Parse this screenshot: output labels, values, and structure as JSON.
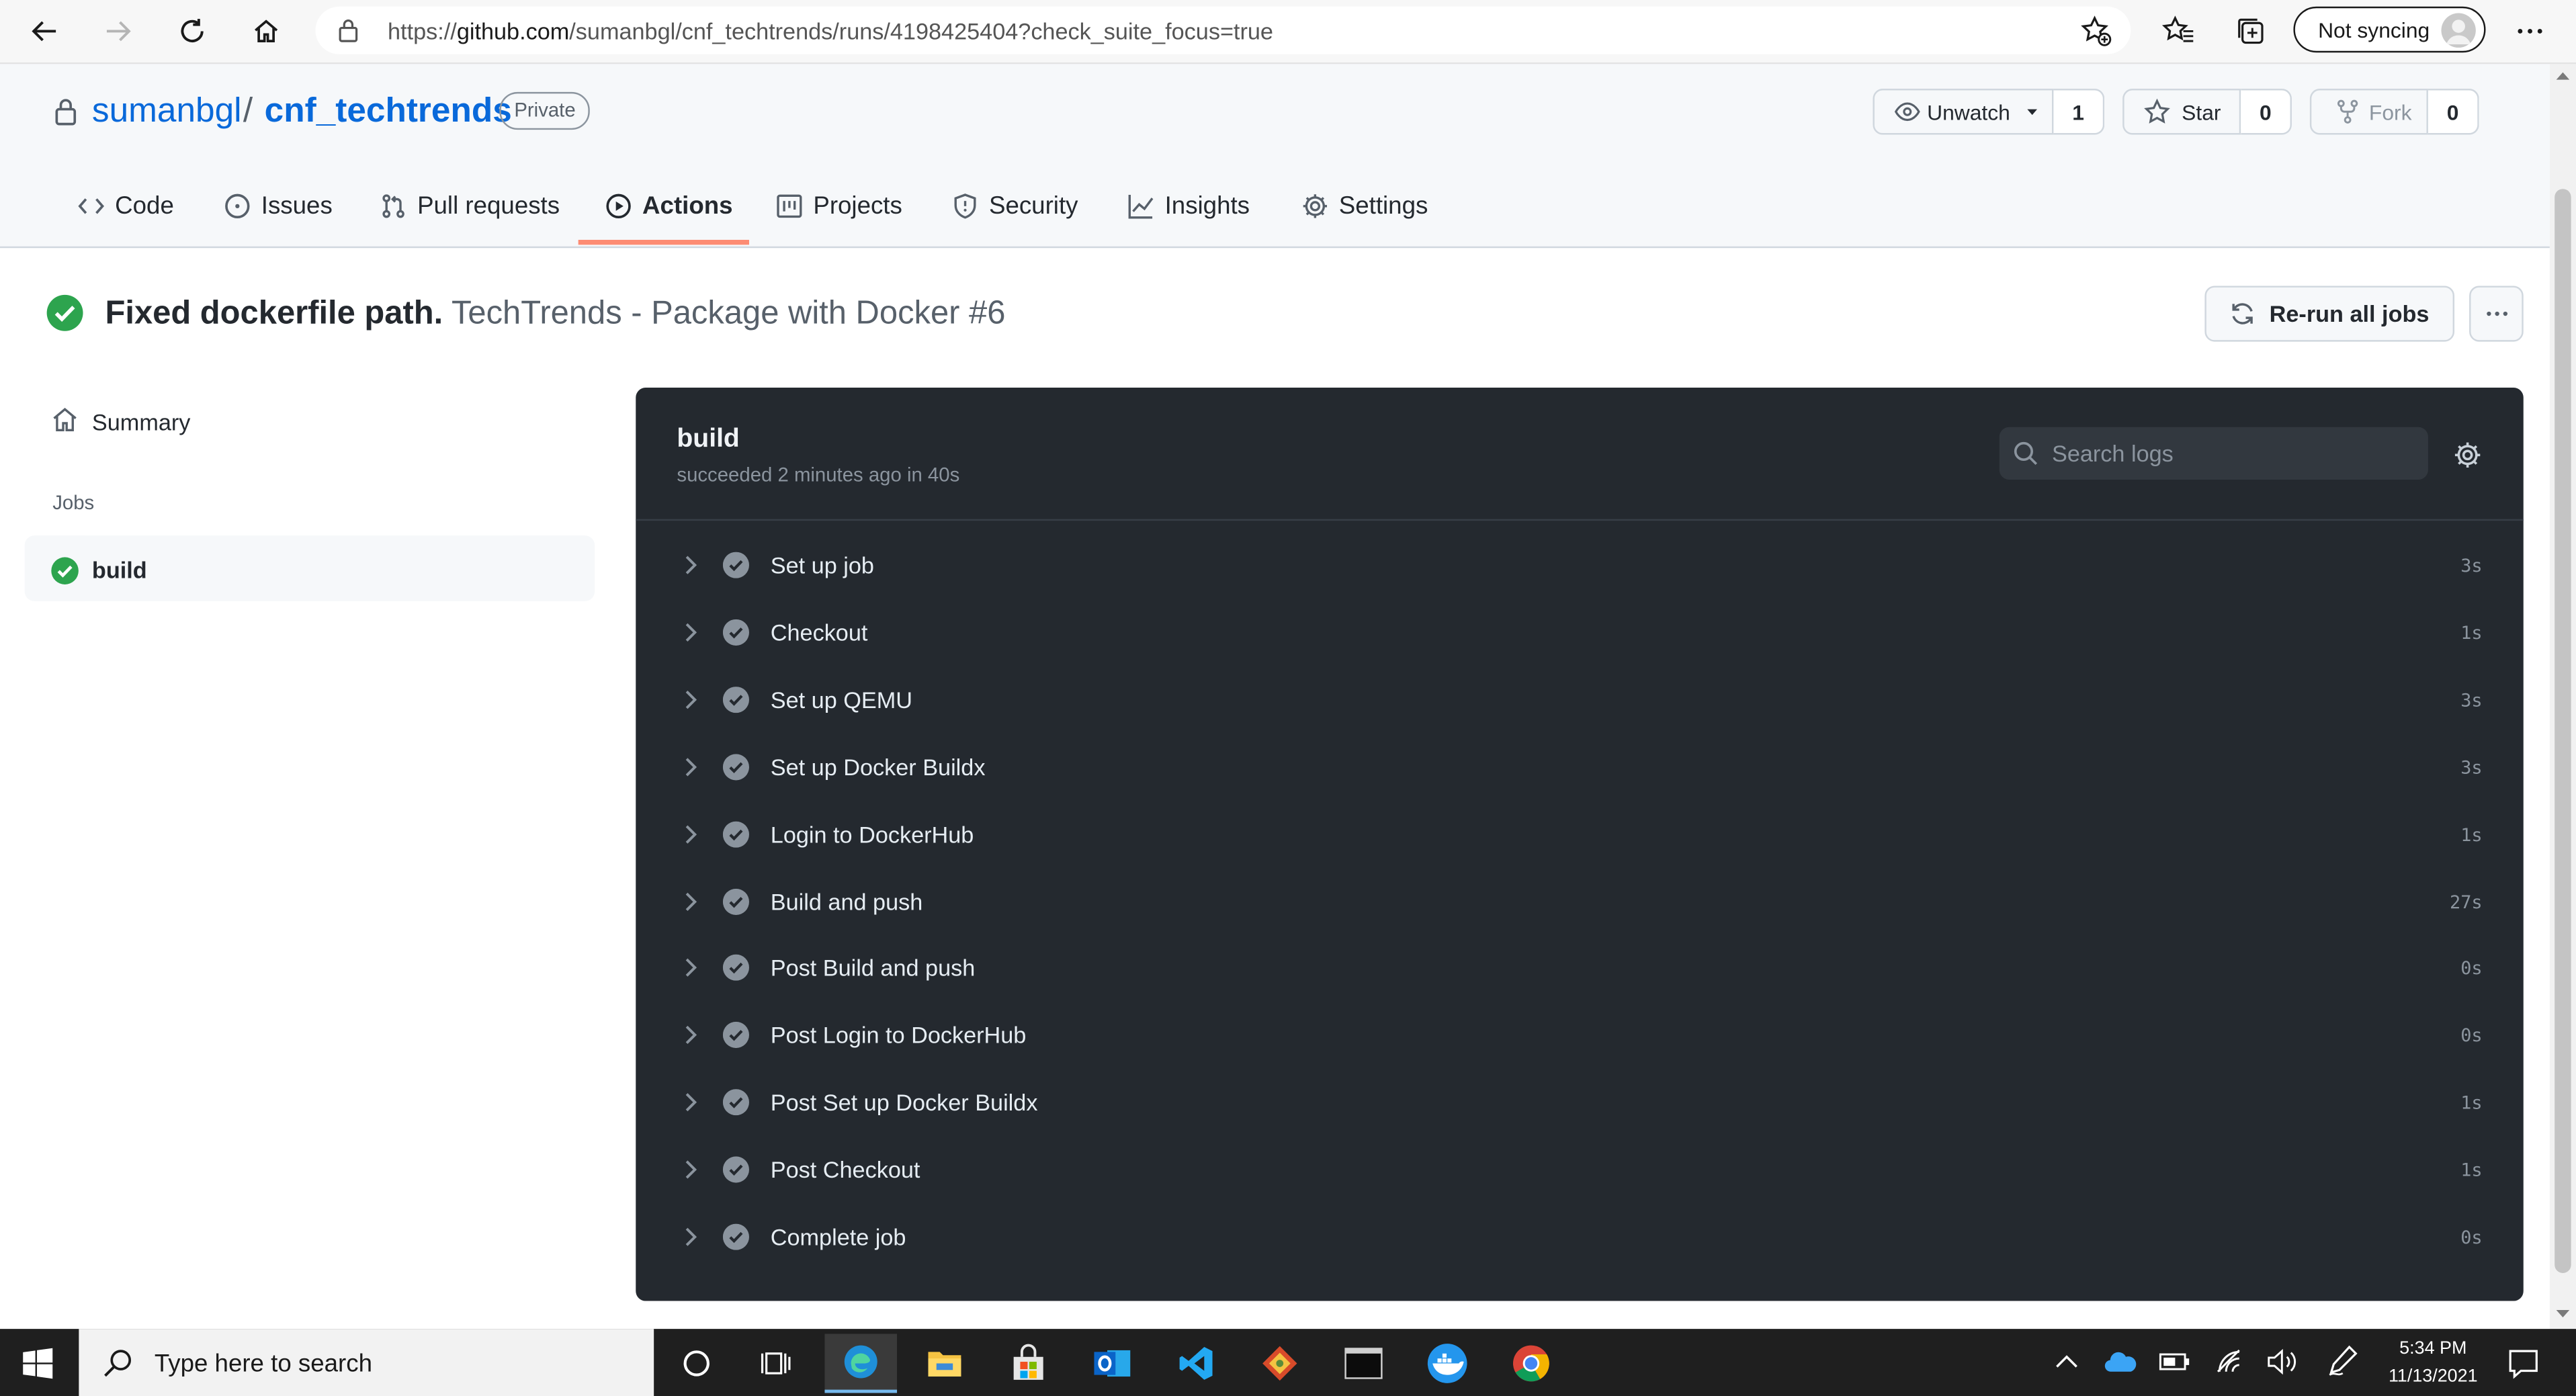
{
  "browser": {
    "url_base": "https://",
    "url_host": "github.com",
    "url_path": "/sumanbgl/cnf_techtrends/runs/4198425404?check_suite_focus=true",
    "profile_label": "Not syncing"
  },
  "repo": {
    "owner": "sumanbgl",
    "separator": "/",
    "name": "cnf_techtrends",
    "visibility": "Private",
    "unwatch_label": "Unwatch",
    "watch_count": "1",
    "star_label": "Star",
    "star_count": "0",
    "fork_label": "Fork",
    "fork_count": "0"
  },
  "tabs": [
    {
      "label": "Code",
      "icon": "code-icon"
    },
    {
      "label": "Issues",
      "icon": "issue-icon"
    },
    {
      "label": "Pull requests",
      "icon": "pull-request-icon"
    },
    {
      "label": "Actions",
      "icon": "play-icon",
      "active": true
    },
    {
      "label": "Projects",
      "icon": "project-icon"
    },
    {
      "label": "Security",
      "icon": "shield-icon"
    },
    {
      "label": "Insights",
      "icon": "graph-icon"
    },
    {
      "label": "Settings",
      "icon": "gear-icon"
    }
  ],
  "run": {
    "commit_message": "Fixed dockerfile path.",
    "workflow": "TechTrends - Package with Docker #6",
    "rerun_label": "Re-run all jobs"
  },
  "sidebar": {
    "summary_label": "Summary",
    "jobs_heading": "Jobs",
    "job_name": "build"
  },
  "log": {
    "job_title": "build",
    "job_status": "succeeded 2 minutes ago in 40s",
    "search_placeholder": "Search logs",
    "steps": [
      {
        "label": "Set up job",
        "time": "3s"
      },
      {
        "label": "Checkout",
        "time": "1s"
      },
      {
        "label": "Set up QEMU",
        "time": "3s"
      },
      {
        "label": "Set up Docker Buildx",
        "time": "3s"
      },
      {
        "label": "Login to DockerHub",
        "time": "1s"
      },
      {
        "label": "Build and push",
        "time": "27s"
      },
      {
        "label": "Post Build and push",
        "time": "0s"
      },
      {
        "label": "Post Login to DockerHub",
        "time": "0s"
      },
      {
        "label": "Post Set up Docker Buildx",
        "time": "1s"
      },
      {
        "label": "Post Checkout",
        "time": "1s"
      },
      {
        "label": "Complete job",
        "time": "0s"
      }
    ]
  },
  "taskbar": {
    "search_placeholder": "Type here to search",
    "time": "5:34 PM",
    "date": "11/13/2021"
  },
  "colors": {
    "success": "#2da44e",
    "link": "#0969da",
    "active_tab_underline": "#fd8c73",
    "log_panel_bg": "#24292f"
  }
}
